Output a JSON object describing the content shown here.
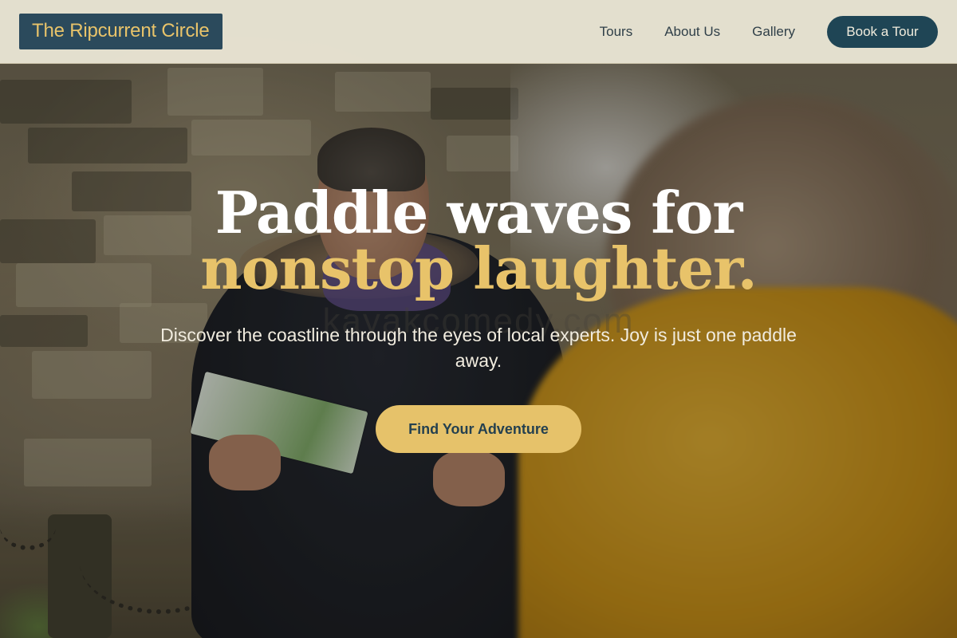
{
  "header": {
    "logo_text": "The Ripcurrent Circle",
    "nav": [
      {
        "label": "Tours"
      },
      {
        "label": "About Us"
      },
      {
        "label": "Gallery"
      }
    ],
    "cta_label": "Book a Tour"
  },
  "hero": {
    "headline_line1": "Paddle waves for",
    "headline_line2": "nonstop laughter.",
    "subtitle": "Discover the coastline through the eyes of local experts. Joy is just one paddle away.",
    "cta_label": "Find Your Adventure",
    "watermark": "kayakcomedy.com",
    "background_image": "man reading a map beside a stone wall, person in yellow jacket in foreground"
  },
  "colors": {
    "accent_gold": "#e8c36a",
    "brand_navy": "#1f4555",
    "header_bg": "#f0ecda"
  }
}
